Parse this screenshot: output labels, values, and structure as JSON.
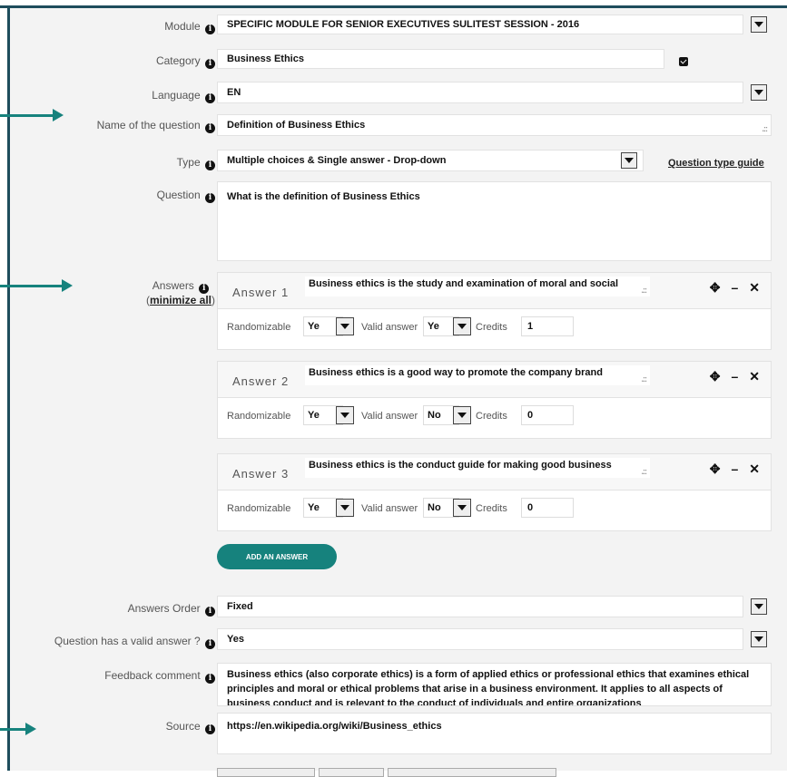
{
  "form": {
    "module": {
      "label": "Module",
      "value": "SPECIFIC MODULE FOR SENIOR EXECUTIVES SULITEST SESSION - 2016"
    },
    "category": {
      "label": "Category",
      "value": "Business Ethics"
    },
    "language": {
      "label": "Language",
      "value": "EN"
    },
    "name": {
      "label": "Name of the question",
      "value": "Definition of Business Ethics"
    },
    "type": {
      "label": "Type",
      "value": "Multiple choices & Single answer - Drop-down",
      "guide_link": "Question type guide"
    },
    "question": {
      "label": "Question",
      "value": "What is the definition of Business Ethics"
    },
    "answers": {
      "label": "Answers",
      "minimize_link": "minimize all",
      "randomizable_label": "Randomizable",
      "valid_label": "Valid answer",
      "credits_label": "Credits",
      "items": [
        {
          "title": "Answer 1",
          "text": "Business ethics is the study and examination of moral and social",
          "randomizable": "Ye",
          "valid": "Ye",
          "credits": "1"
        },
        {
          "title": "Answer 2",
          "text": "Business ethics is a good way to promote the company brand",
          "randomizable": "Ye",
          "valid": "No",
          "credits": "0"
        },
        {
          "title": "Answer 3",
          "text": "Business ethics is the conduct guide for making good business",
          "randomizable": "Ye",
          "valid": "No",
          "credits": "0"
        }
      ],
      "add_button": "ADD AN ANSWER"
    },
    "answers_order": {
      "label": "Answers Order",
      "value": "Fixed"
    },
    "has_valid": {
      "label": "Question has a valid answer ?",
      "value": "Yes"
    },
    "feedback": {
      "label": "Feedback comment",
      "value": "Business ethics (also corporate ethics) is a form of applied ethics or professional ethics that examines ethical principles and moral or ethical problems that arise in a business environment. It applies to all aspects of business conduct and is relevant to the conduct of individuals and entire organizations"
    },
    "source": {
      "label": "Source",
      "value": "https://en.wikipedia.org/wiki/Business_ethics"
    }
  },
  "icons": {
    "info": "info-icon",
    "move": "move-icon",
    "minus": "minus-icon",
    "close": "close-icon",
    "dropdown": "chevron-down-icon"
  },
  "colors": {
    "accent": "#16827d",
    "frame": "#1e4d5c"
  }
}
